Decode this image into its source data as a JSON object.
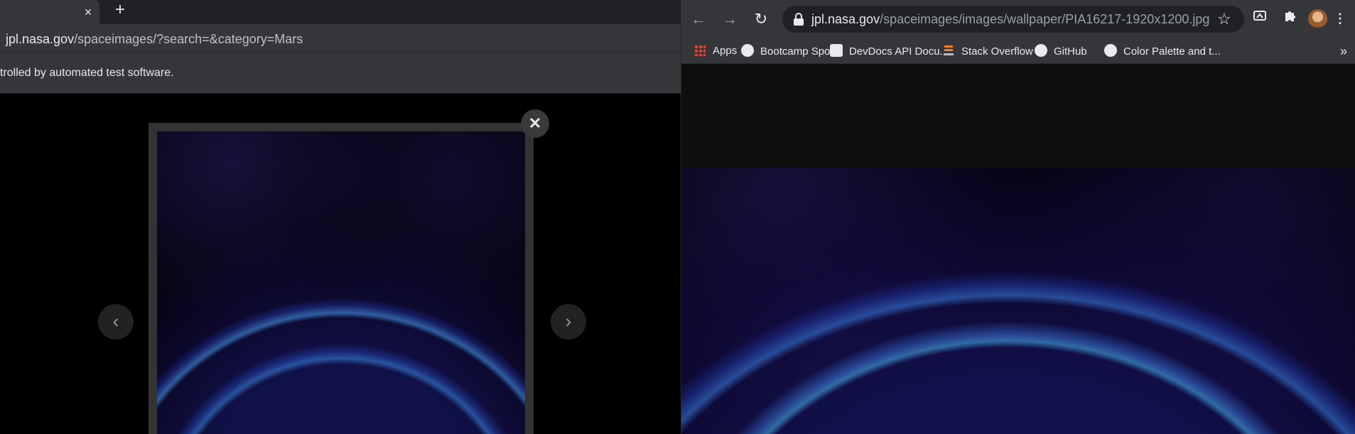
{
  "left_window": {
    "tab_close_glyph": "×",
    "new_tab_glyph": "+",
    "url_host": "jpl.nasa.gov",
    "url_path": "/spaceimages/?search=&category=Mars",
    "infobar_text": "trolled by automated test software.",
    "modal": {
      "close_glyph": "✕",
      "prev_glyph": "‹",
      "next_glyph": "›"
    }
  },
  "right_window": {
    "nav": {
      "back": "←",
      "forward": "→",
      "reload": "↻"
    },
    "url_host": "jpl.nasa.gov",
    "url_path": "/spaceimages/images/wallpaper/PIA16217-1920x1200.jpg",
    "star_glyph": "☆",
    "menu_glyph": "⋮",
    "bookmarks": [
      {
        "label": "Apps",
        "icon": "apps-grid-icon"
      },
      {
        "label": "Bootcamp Spot",
        "icon": "globe-icon"
      },
      {
        "label": "DevDocs API Docu...",
        "icon": "devdocs-icon"
      },
      {
        "label": "Stack Overflow",
        "icon": "stackoverflow-icon"
      },
      {
        "label": "GitHub",
        "icon": "github-icon"
      },
      {
        "label": "Color Palette and t...",
        "icon": "globe-icon"
      }
    ],
    "bookmarks_more": "»"
  },
  "colors": {
    "chrome_dark": "#35363a",
    "tabstrip": "#202124",
    "omnibox": "#202124",
    "text": "#e8eaed",
    "text_dim": "#9aa0a6"
  }
}
